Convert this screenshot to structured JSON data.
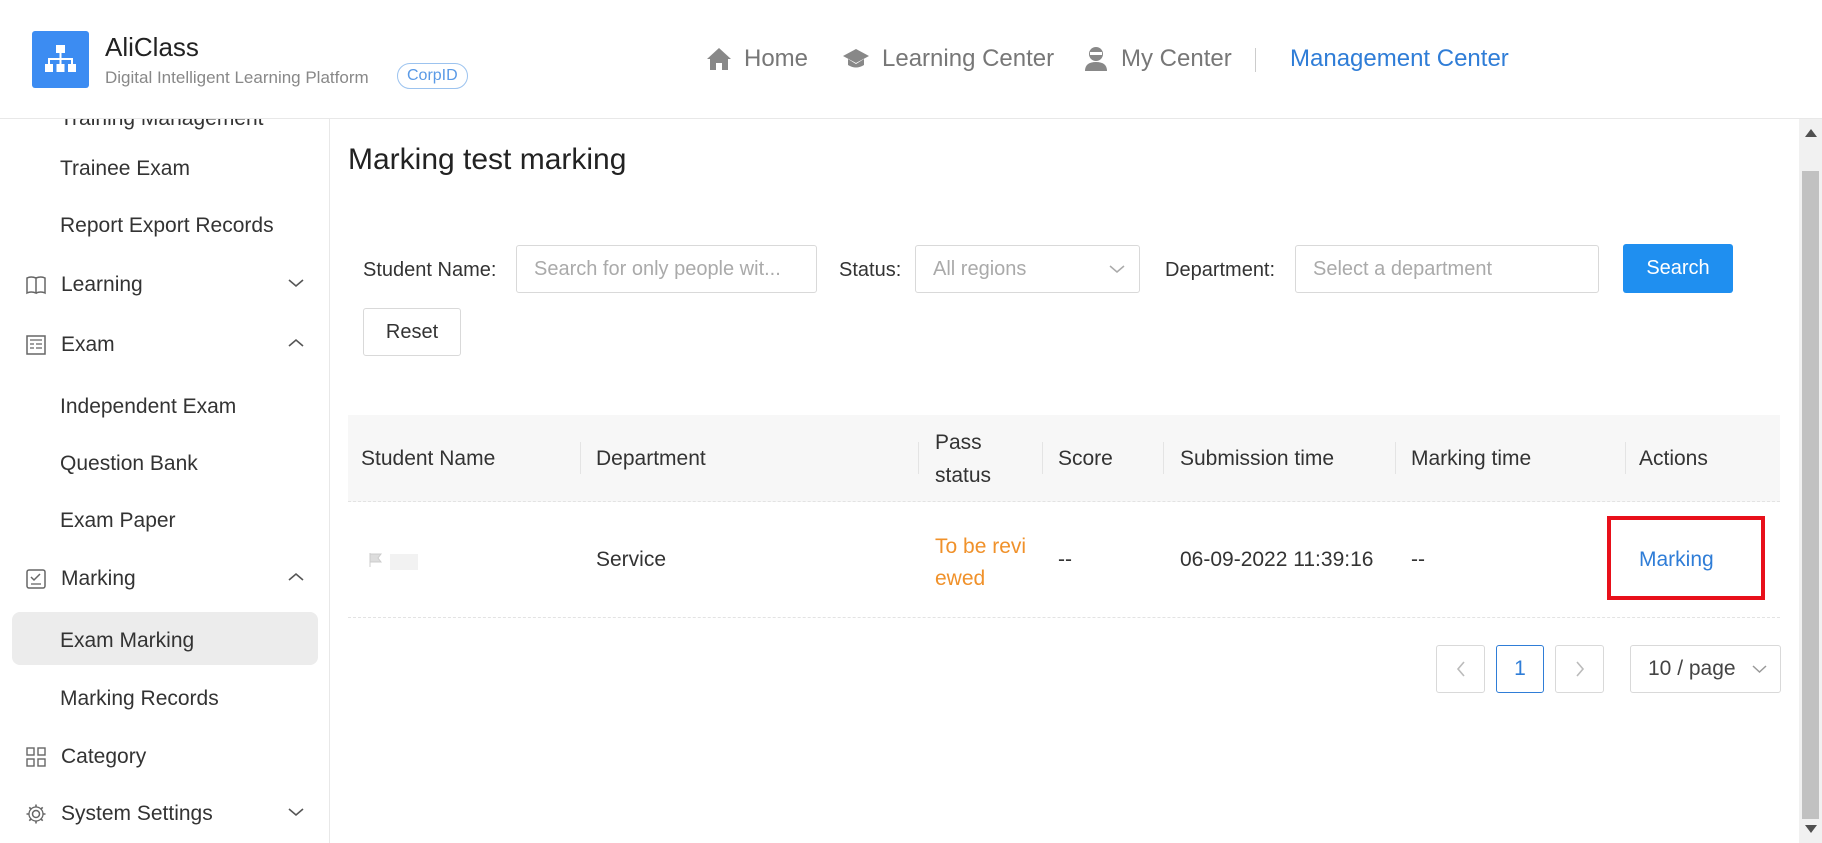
{
  "header": {
    "brand_name": "AliClass",
    "brand_subtitle": "Digital Intelligent Learning Platform",
    "corp_tag": "CorpID",
    "nav": [
      {
        "label": "Home",
        "icon": "home-icon"
      },
      {
        "label": "Learning Center",
        "icon": "graduation-cap-icon"
      },
      {
        "label": "My Center",
        "icon": "user-icon"
      },
      {
        "label": "Management Center",
        "active": true
      }
    ]
  },
  "sidebar": {
    "cut_item": "Training Management",
    "items": [
      {
        "label": "Trainee Exam",
        "level": 2
      },
      {
        "label": "Report Export Records",
        "level": 2
      },
      {
        "label": "Learning",
        "level": 1,
        "icon": "book-icon",
        "expanded": false
      },
      {
        "label": "Exam",
        "level": 1,
        "icon": "exam-icon",
        "expanded": true
      },
      {
        "label": "Independent Exam",
        "level": 2
      },
      {
        "label": "Question Bank",
        "level": 2
      },
      {
        "label": "Exam Paper",
        "level": 2
      },
      {
        "label": "Marking",
        "level": 1,
        "icon": "marking-icon",
        "expanded": true
      },
      {
        "label": "Exam Marking",
        "level": 2,
        "active": true
      },
      {
        "label": "Marking Records",
        "level": 2
      },
      {
        "label": "Category",
        "level": 1,
        "icon": "grid-icon"
      },
      {
        "label": "System Settings",
        "level": 1,
        "icon": "gear-icon",
        "expanded": false
      }
    ]
  },
  "main": {
    "title": "Marking test marking",
    "filters": {
      "student_label": "Student Name",
      "student_placeholder": "Search for only people wit...",
      "status_label": "Status",
      "status_value": "All regions",
      "department_label": "Department",
      "department_placeholder": "Select a department",
      "search_button": "Search",
      "reset_button": "Reset"
    },
    "table": {
      "columns": [
        "Student Name",
        "Department",
        "Pass status",
        "Score",
        "Submission time",
        "Marking time",
        "Actions"
      ],
      "rows": [
        {
          "student": "",
          "department": "Service",
          "pass_status": "To be reviewed",
          "score": "--",
          "submission_time": "06-09-2022 11:39:16",
          "marking_time": "--",
          "action": "Marking"
        }
      ]
    },
    "pagination": {
      "current_page": "1",
      "page_size": "10 / page"
    }
  },
  "colors": {
    "accent": "#1f8ff0",
    "link": "#2f7dd7",
    "pending": "#f0912a",
    "highlight": "#e8101a"
  }
}
